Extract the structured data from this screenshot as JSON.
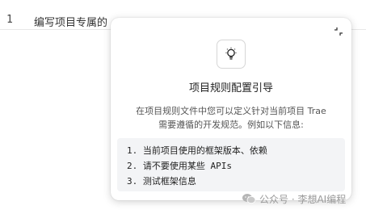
{
  "editor": {
    "line_number": "1",
    "line_text": "编写项目专属的"
  },
  "popup": {
    "icon": "lightbulb-icon",
    "collapse_icon": "collapse-arrows-icon",
    "title": "项目规则配置引导",
    "description_line1": "在项目规则文件中您可以定义针对当前项目 Trae",
    "description_line2": "需要遵循的开发规范。例如以下信息:",
    "items": [
      "1. 当前项目使用的框架版本、依赖",
      "2. 请不要使用某些 APIs",
      "3. 测试框架信息"
    ]
  },
  "watermark": {
    "icon": "wechat-icon",
    "text": "公众号 · 李想AI编程"
  }
}
